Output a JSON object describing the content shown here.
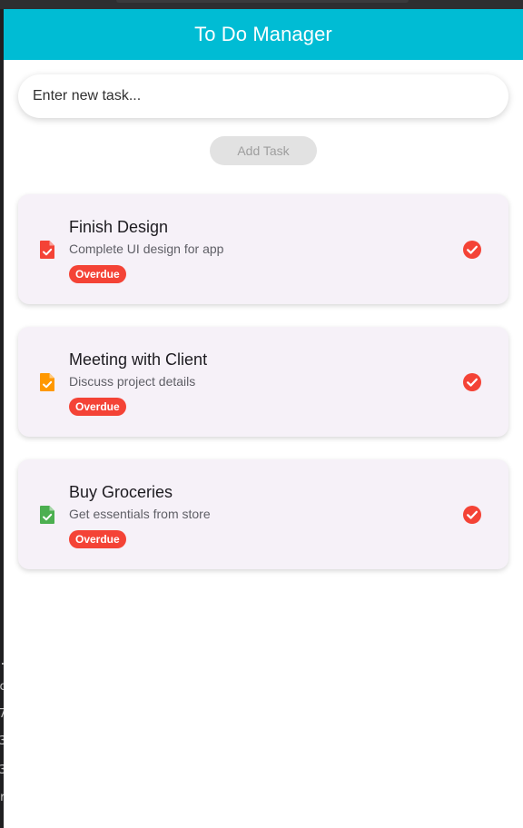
{
  "app": {
    "title": "To Do Manager",
    "accent_color": "#00bcd4"
  },
  "input": {
    "placeholder": "Enter new task..."
  },
  "add_button": {
    "label": "Add Task",
    "state": "disabled"
  },
  "tasks": [
    {
      "title": "Finish Design",
      "description": "Complete UI design for app",
      "badge": "Overdue",
      "icon": "task-document-icon",
      "icon_color": "#f44336",
      "completed": true
    },
    {
      "title": "Meeting with Client",
      "description": "Discuss project details",
      "badge": "Overdue",
      "icon": "task-document-icon",
      "icon_color": "#ff9800",
      "completed": true
    },
    {
      "title": "Buy Groceries",
      "description": "Get essentials from store",
      "badge": "Overdue",
      "icon": "task-document-icon",
      "icon_color": "#4caf50",
      "completed": true
    }
  ],
  "colors": {
    "overdue_badge": "#f44336",
    "check_icon": "#f44336",
    "card_background": "#f6f1f8"
  },
  "background_gutter": {
    "chars": [
      ".",
      "c",
      "7",
      "3",
      "3",
      "r"
    ]
  }
}
